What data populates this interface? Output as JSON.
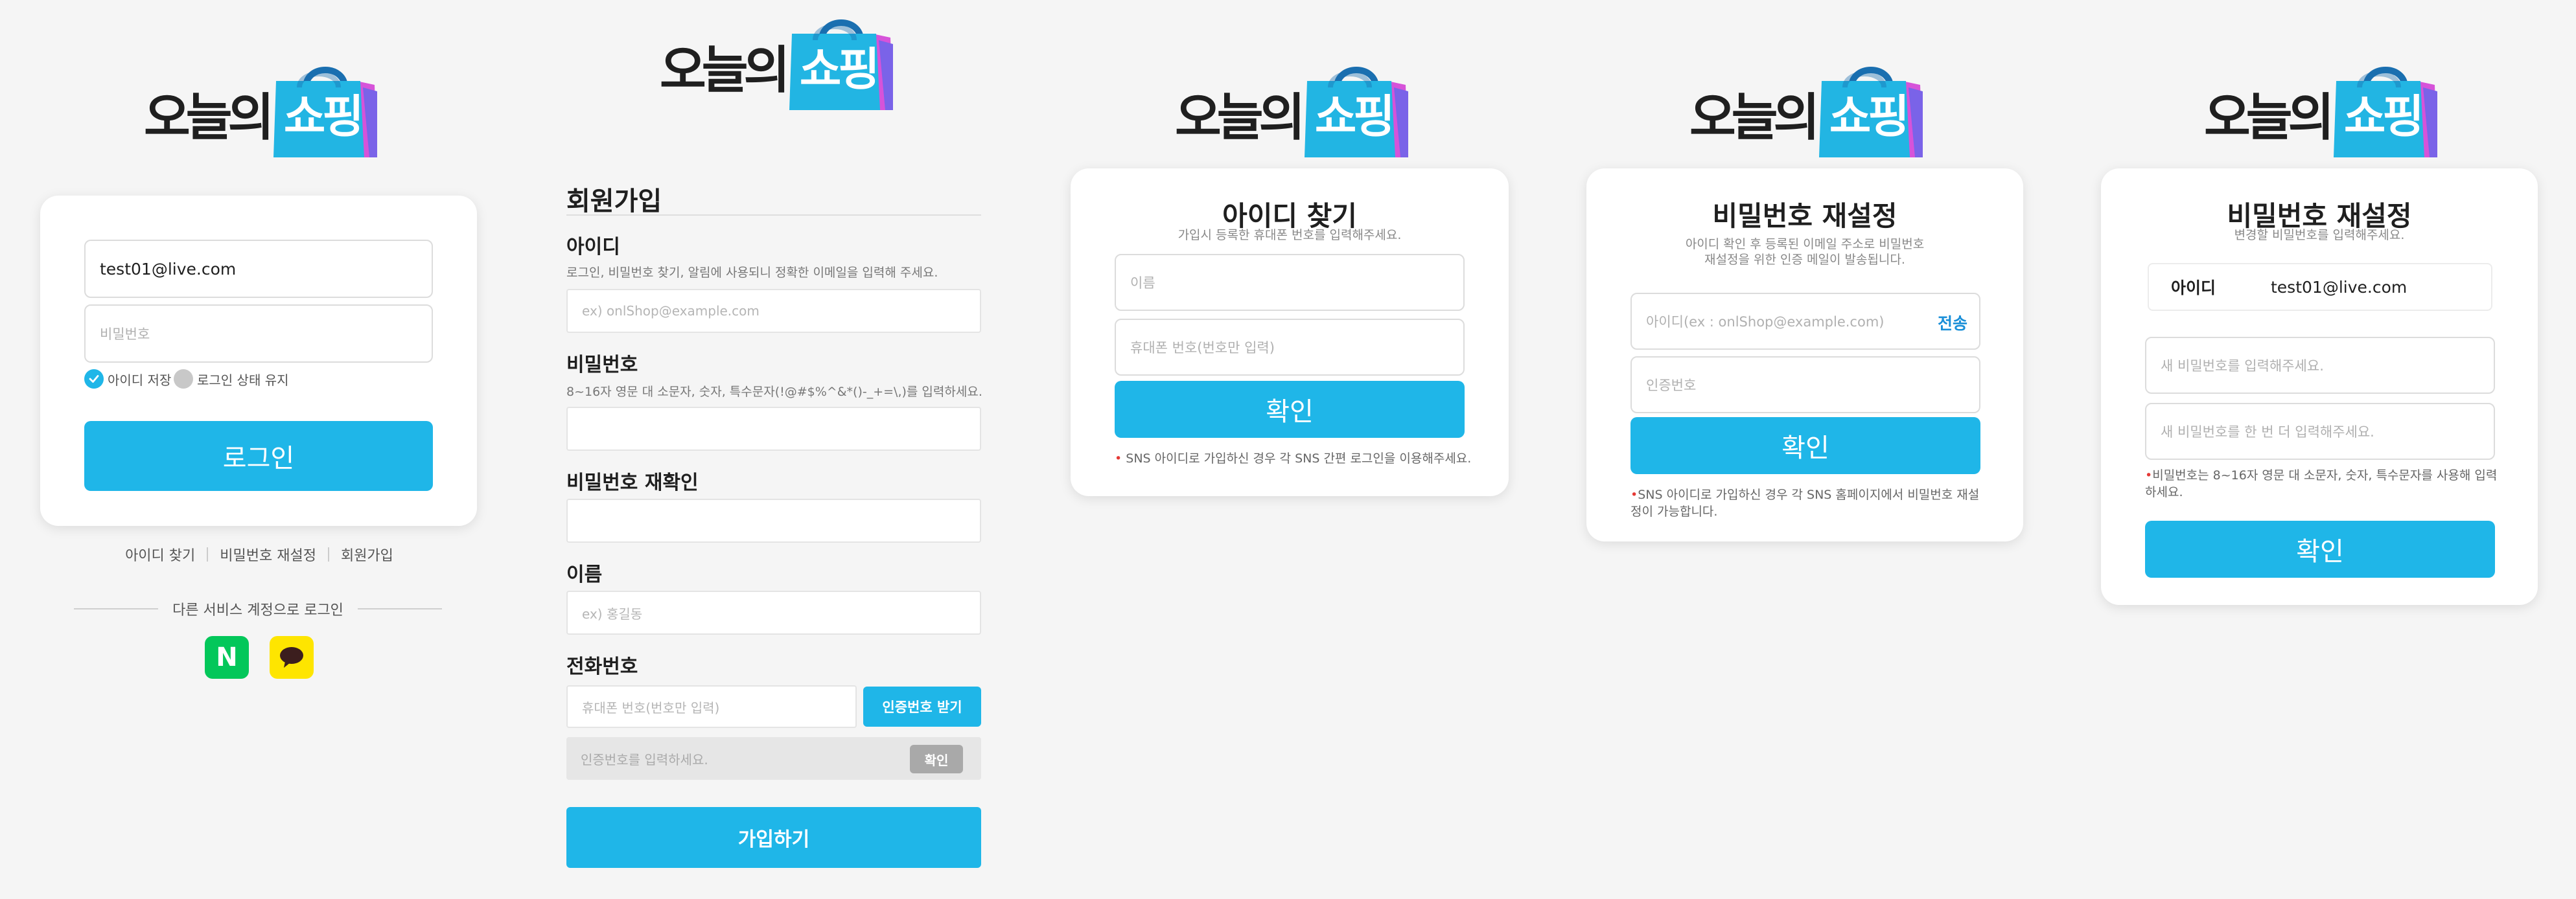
{
  "logo": {
    "text": "오늘의",
    "bag_text": "쇼핑"
  },
  "login": {
    "id_value": "test01@live.com",
    "password_placeholder": "비밀번호",
    "save_id_label": "아이디 저장",
    "keep_login_label": "로그인 상태 유지",
    "save_id_checked": true,
    "keep_login_checked": false,
    "login_button": "로그인",
    "links": [
      "아이디 찾기",
      "비밀번호 재설정",
      "회원가입"
    ],
    "social_title": "다른 서비스 계정으로 로그인",
    "naver_letter": "N",
    "colors": {
      "naver": "#03c75a",
      "kakao": "#fee500",
      "accent": "#1fb6e8"
    }
  },
  "signup": {
    "title": "회원가입",
    "id_label": "아이디",
    "id_help": "로그인, 비밀번호 찾기, 알림에 사용되니 정확한 이메일을 입력해 주세요.",
    "id_placeholder": "ex) onlShop@example.com",
    "password_label": "비밀번호",
    "password_help": "8~16자 영문 대 소문자, 숫자, 특수문자(!@#$%^&*()-_+=\\,)를 입력하세요.",
    "password_confirm_label": "비밀번호 재확인",
    "name_label": "이름",
    "name_placeholder": "ex) 홍길동",
    "phone_label": "전화번호",
    "phone_placeholder": "휴대폰 번호(번호만 입력)",
    "send_code_button": "인증번호 받기",
    "code_placeholder": "인증번호를 입력하세요.",
    "code_confirm_button": "확인",
    "submit_button": "가입하기"
  },
  "find_id": {
    "title": "아이디 찾기",
    "subtitle": "가입시 등록한 휴대폰 번호를 입력해주세요.",
    "name_placeholder": "이름",
    "phone_placeholder": "휴대폰 번호(번호만 입력)",
    "confirm_button": "확인",
    "note": "SNS 아이디로 가입하신 경우 각 SNS 간편 로그인을 이용해주세요."
  },
  "reset_request": {
    "title": "비밀번호 재설정",
    "subtitle_1": "아이디 확인 후 등록된 이메일 주소로 비밀번호",
    "subtitle_2": "재설정을 위한 인증 메일이 발송됩니다.",
    "id_placeholder": "아이디(ex : onlShop@example.com)",
    "send_link": "전송",
    "code_placeholder": "인증번호",
    "confirm_button": "확인",
    "note_1": "SNS 아이디로 가입하신 경우 각 SNS 홈페이지에서 비밀번호 재설",
    "note_2": "정이 가능합니다."
  },
  "reset_new": {
    "title": "비밀번호 재설정",
    "subtitle": "변경할 비밀번호를 입력해주세요.",
    "id_label": "아이디",
    "id_value": "test01@live.com",
    "new_password_placeholder": "새 비밀번호를 입력해주세요.",
    "confirm_password_placeholder": "새 비밀번호를 한 번 더 입력해주세요.",
    "note_1": "비밀번호는 8~16자 영문 대 소문자, 숫자, 특수문자를 사용해 입력",
    "note_2": "하세요.",
    "confirm_button": "확인"
  }
}
